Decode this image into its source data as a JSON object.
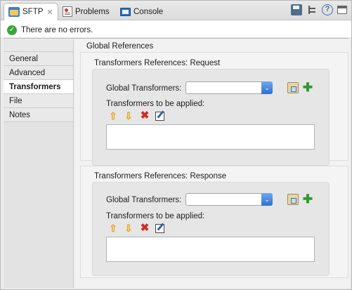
{
  "tabs": [
    {
      "label": "SFTP",
      "icon": "folder-icon",
      "active": true,
      "closable": true
    },
    {
      "label": "Problems",
      "icon": "problems-icon"
    },
    {
      "label": "Console",
      "icon": "console-icon"
    }
  ],
  "toolbar": {
    "icons": [
      "save-icon",
      "tree-icon",
      "help-icon",
      "window-icon"
    ],
    "help_label": "?"
  },
  "status": {
    "icon": "check-icon",
    "text": "There are no errors."
  },
  "sidebar": {
    "items": [
      {
        "label": "General"
      },
      {
        "label": "Advanced"
      },
      {
        "label": "Transformers",
        "selected": true
      },
      {
        "label": "File"
      },
      {
        "label": "Notes"
      }
    ]
  },
  "main": {
    "section_title": "Global References",
    "request": {
      "title": "Transformers References: Request",
      "global_label": "Global Transformers:",
      "global_value": "",
      "apply_label": "Transformers to be applied:"
    },
    "response": {
      "title": "Transformers References: Response",
      "global_label": "Global Transformers:",
      "global_value": "",
      "apply_label": "Transformers to be applied:"
    }
  },
  "glyphs": {
    "close": "✕",
    "dropdown": "⌄",
    "up": "⇧",
    "down": "⇩",
    "delete": "✖",
    "add": "✚",
    "check": "✓"
  },
  "colors": {
    "ok_green": "#3aa53a",
    "add_green": "#2e9a2e",
    "delete_red": "#d12b22",
    "arrow_yellow": "#e3a713",
    "dropdown_blue": "#2f6fd1"
  }
}
